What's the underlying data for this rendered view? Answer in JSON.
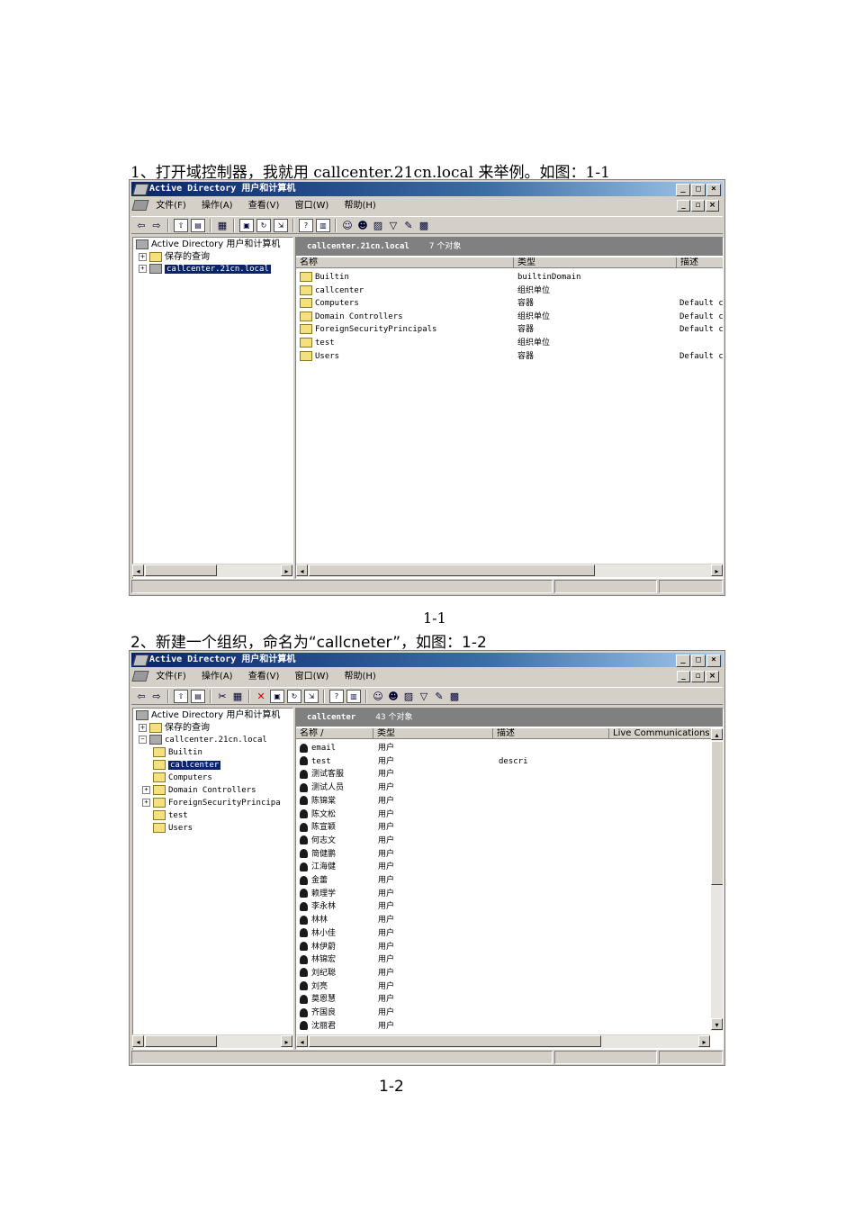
{
  "step1": {
    "text": "1、打开域控制器，我就用 callcenter.21cn.local 来举例。如图：1-1",
    "caption": "1-1"
  },
  "step2": {
    "text": "2、新建一个组织，命名为“callcneter”，如图：1-2",
    "caption": "1-2"
  },
  "window1": {
    "title": "Active Directory 用户和计算机",
    "menu": [
      "文件(F)",
      "操作(A)",
      "查看(V)",
      "窗口(W)",
      "帮助(H)"
    ],
    "tree": {
      "root": "Active Directory 用户和计算机",
      "saved_queries": "保存的查询",
      "domain": "callcenter.21cn.local"
    },
    "header": {
      "name": "callcenter.21cn.local",
      "count": "7 个对象"
    },
    "columns": [
      "名称",
      "类型",
      "描述"
    ],
    "rows": [
      {
        "name": "Builtin",
        "type": "builtinDomain",
        "desc": ""
      },
      {
        "name": "callcenter",
        "type": "组织单位",
        "desc": ""
      },
      {
        "name": "Computers",
        "type": "容器",
        "desc": "Default c"
      },
      {
        "name": "Domain Controllers",
        "type": "组织单位",
        "desc": "Default c"
      },
      {
        "name": "ForeignSecurityPrincipals",
        "type": "容器",
        "desc": "Default c"
      },
      {
        "name": "test",
        "type": "组织单位",
        "desc": ""
      },
      {
        "name": "Users",
        "type": "容器",
        "desc": "Default c"
      }
    ]
  },
  "window2": {
    "title": "Active Directory 用户和计算机",
    "menu": [
      "文件(F)",
      "操作(A)",
      "查看(V)",
      "窗口(W)",
      "帮助(H)"
    ],
    "tree": {
      "root": "Active Directory 用户和计算机",
      "saved_queries": "保存的查询",
      "domain": "callcenter.21cn.local",
      "children": [
        "Builtin",
        "callcenter",
        "Computers",
        "Domain Controllers",
        "ForeignSecurityPrincipa",
        "test",
        "Users"
      ]
    },
    "header": {
      "name": "callcenter",
      "count": "43 个对象"
    },
    "columns": [
      "名称 /",
      "类型",
      "描述",
      "Live Communications 1"
    ],
    "rows": [
      {
        "name": "email",
        "type": "用户",
        "desc": ""
      },
      {
        "name": "test",
        "type": "用户",
        "desc": "descri"
      },
      {
        "name": "测试客服",
        "type": "用户",
        "desc": ""
      },
      {
        "name": "测试人员",
        "type": "用户",
        "desc": ""
      },
      {
        "name": "陈锦棠",
        "type": "用户",
        "desc": ""
      },
      {
        "name": "陈文松",
        "type": "用户",
        "desc": ""
      },
      {
        "name": "陈宣颖",
        "type": "用户",
        "desc": ""
      },
      {
        "name": "何志文",
        "type": "用户",
        "desc": ""
      },
      {
        "name": "简健鹏",
        "type": "用户",
        "desc": ""
      },
      {
        "name": "江海健",
        "type": "用户",
        "desc": ""
      },
      {
        "name": "金蕾",
        "type": "用户",
        "desc": ""
      },
      {
        "name": "赖理学",
        "type": "用户",
        "desc": ""
      },
      {
        "name": "李永林",
        "type": "用户",
        "desc": ""
      },
      {
        "name": "林林",
        "type": "用户",
        "desc": ""
      },
      {
        "name": "林小佳",
        "type": "用户",
        "desc": ""
      },
      {
        "name": "林伊蔚",
        "type": "用户",
        "desc": ""
      },
      {
        "name": "林锦宏",
        "type": "用户",
        "desc": ""
      },
      {
        "name": "刘纪聪",
        "type": "用户",
        "desc": ""
      },
      {
        "name": "刘亮",
        "type": "用户",
        "desc": ""
      },
      {
        "name": "莫恩慧",
        "type": "用户",
        "desc": ""
      },
      {
        "name": "齐国良",
        "type": "用户",
        "desc": ""
      },
      {
        "name": "沈丽君",
        "type": "用户",
        "desc": ""
      }
    ]
  }
}
